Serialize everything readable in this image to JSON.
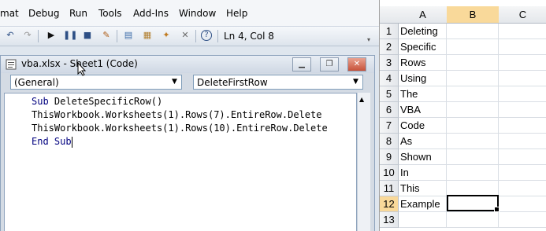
{
  "menu": {
    "items": [
      {
        "label": "mat"
      },
      {
        "label": "Debug"
      },
      {
        "label": "Run"
      },
      {
        "label": "Tools"
      },
      {
        "label": "Add-Ins"
      },
      {
        "label": "Window"
      },
      {
        "label": "Help"
      }
    ]
  },
  "toolbar": {
    "icons": [
      "undo-icon",
      "redo-icon",
      "run-icon",
      "break-icon",
      "reset-icon",
      "design-mode-icon",
      "project-explorer-icon",
      "properties-icon",
      "object-browser-icon",
      "toolbox-icon",
      "help-icon"
    ],
    "status": "Ln 4, Col 8"
  },
  "code_window": {
    "title": "vba.xlsx - Sheet1 (Code)",
    "object_combo": "(General)",
    "procedure_combo": "DeleteFirstRow",
    "lines": [
      {
        "kw": "Sub",
        "rest": " DeleteSpecificRow()"
      },
      {
        "kw": "",
        "rest": "ThisWorkbook.Worksheets(1).Rows(7).EntireRow.Delete"
      },
      {
        "kw": "",
        "rest": "ThisWorkbook.Worksheets(1).Rows(10).EntireRow.Delete"
      },
      {
        "kw": "End Sub",
        "rest": ""
      }
    ]
  },
  "sheet": {
    "columns": [
      "A",
      "B",
      "C"
    ],
    "rows": [
      {
        "n": "1",
        "a": "Deleting"
      },
      {
        "n": "2",
        "a": "Specific"
      },
      {
        "n": "3",
        "a": "Rows"
      },
      {
        "n": "4",
        "a": "Using"
      },
      {
        "n": "5",
        "a": "The"
      },
      {
        "n": "6",
        "a": "VBA"
      },
      {
        "n": "7",
        "a": "Code"
      },
      {
        "n": "8",
        "a": "As"
      },
      {
        "n": "9",
        "a": "Shown"
      },
      {
        "n": "10",
        "a": "In"
      },
      {
        "n": "11",
        "a": "This"
      },
      {
        "n": "12",
        "a": "Example"
      },
      {
        "n": "13",
        "a": ""
      }
    ],
    "active_cell": "B12",
    "accent": "#f9d99a"
  }
}
